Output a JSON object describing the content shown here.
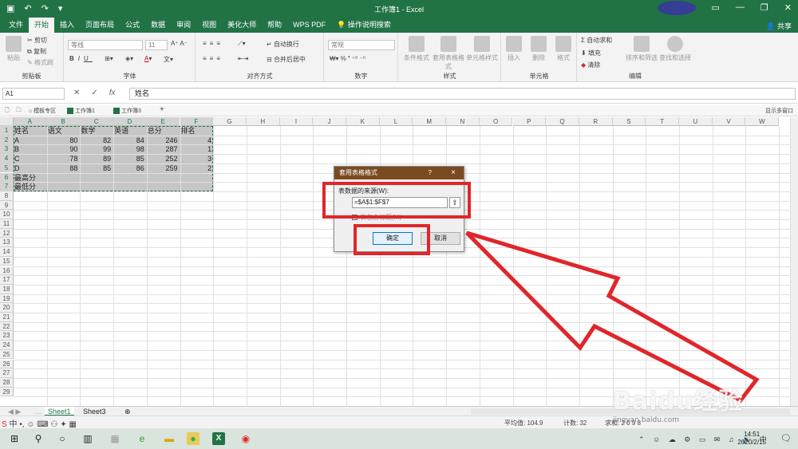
{
  "titlebar": {
    "title": "工作簿1 - Excel"
  },
  "ribbon_tabs": [
    "文件",
    "开始",
    "插入",
    "页面布局",
    "公式",
    "数据",
    "审阅",
    "视图",
    "美化大师",
    "帮助",
    "WPS PDF",
    "操作说明搜索"
  ],
  "share": "共享",
  "ribbon": {
    "clipboard": {
      "paste": "粘贴",
      "cut": "剪切",
      "copy": "复制",
      "format_painter": "格式刷",
      "label": "剪贴板"
    },
    "font": {
      "font_name": "等线",
      "font_size": "11",
      "label": "字体"
    },
    "alignment": {
      "wrap": "自动换行",
      "merge": "合并后居中",
      "label": "对齐方式"
    },
    "number": {
      "format": "常规",
      "label": "数字"
    },
    "styles": {
      "cond": "条件格式",
      "table": "套用表格格式",
      "cell": "单元格样式",
      "label": "样式"
    },
    "cells": {
      "insert": "插入",
      "delete": "删除",
      "format": "格式",
      "label": "单元格"
    },
    "editing": {
      "autosum": "自动求和",
      "fill": "填充",
      "clear": "清除",
      "sort": "排序和筛选",
      "find": "查找和选择",
      "label": "编辑"
    }
  },
  "formula_bar": {
    "name_box": "A1",
    "fx": "fx",
    "content": "姓名"
  },
  "doc_tabs": {
    "template": "模板专区",
    "book1": "工作簿1",
    "book3": "工作簿3",
    "multi": "显示多窗口"
  },
  "columns": [
    "A",
    "B",
    "C",
    "D",
    "E",
    "F",
    "G",
    "H",
    "I",
    "J",
    "K",
    "L",
    "M",
    "N",
    "O",
    "P",
    "Q",
    "R",
    "S",
    "T",
    "U",
    "V",
    "W"
  ],
  "rows": [
    "1",
    "2",
    "3",
    "4",
    "5",
    "6",
    "7",
    "8",
    "9",
    "10",
    "11",
    "12",
    "13",
    "14",
    "15",
    "16",
    "17",
    "18",
    "19",
    "20",
    "21",
    "22",
    "23",
    "24",
    "25",
    "26",
    "27",
    "28",
    "29"
  ],
  "table": {
    "header": [
      "姓名",
      "语文",
      "数学",
      "英语",
      "总分",
      "排名"
    ],
    "rows": [
      [
        "A",
        "80",
        "82",
        "84",
        "246",
        "4"
      ],
      [
        "B",
        "90",
        "99",
        "98",
        "287",
        "1"
      ],
      [
        "C",
        "78",
        "89",
        "85",
        "252",
        "3"
      ],
      [
        "D",
        "88",
        "85",
        "86",
        "259",
        "2"
      ],
      [
        "最高分",
        "",
        "",
        "",
        "",
        ""
      ],
      [
        "最低分",
        "",
        "",
        "",
        "",
        ""
      ]
    ]
  },
  "dialog": {
    "title": "套用表格格式",
    "help": "?",
    "close": "×",
    "source_label": "表数据的来源(W):",
    "source_value": "=$A$1:$F$7",
    "header_checkbox": "表包含标题(M)",
    "ok": "确定",
    "cancel": "取消"
  },
  "sheets": [
    "Sheet1",
    "Sheet3"
  ],
  "status": {
    "average": "平均值: 104.9",
    "count": "计数: 32",
    "sum": "求和: 2 0 9 8"
  },
  "taskbar": {
    "time": "14:51",
    "date": "2020/2/15"
  },
  "watermark": {
    "brand": "Baidu经验",
    "url": "jingyan.baidu.com"
  },
  "colors": {
    "excel_green": "#217346",
    "highlight_red": "#e0262b",
    "dialog_title": "#7a4b20"
  }
}
